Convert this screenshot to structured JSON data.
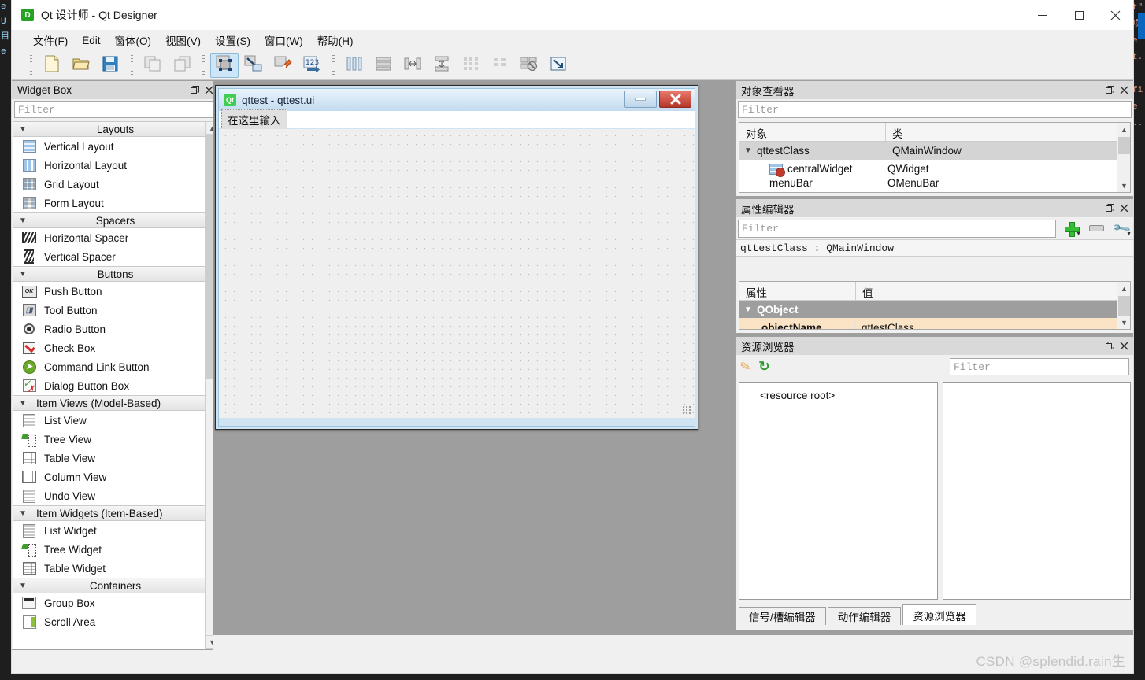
{
  "app": {
    "icon": "D",
    "title": "Qt 设计师 - Qt Designer",
    "window_controls": {
      "minimize": "minimize-icon",
      "maximize": "maximize-icon",
      "close": "close-icon"
    }
  },
  "menubar": {
    "items": [
      {
        "label": "文件(F)"
      },
      {
        "label": "Edit"
      },
      {
        "label": "窗体(O)"
      },
      {
        "label": "视图(V)"
      },
      {
        "label": "设置(S)"
      },
      {
        "label": "窗口(W)"
      },
      {
        "label": "帮助(H)"
      }
    ]
  },
  "toolbar": {
    "groups": [
      {
        "buttons": [
          {
            "name": "new-form-button",
            "icon": "new-file-icon"
          },
          {
            "name": "open-form-button",
            "icon": "open-folder-icon"
          },
          {
            "name": "save-form-button",
            "icon": "save-disk-icon"
          }
        ]
      },
      {
        "buttons": [
          {
            "name": "undo-button",
            "icon": "undo-icon"
          },
          {
            "name": "redo-button",
            "icon": "redo-icon"
          }
        ]
      },
      {
        "buttons": [
          {
            "name": "edit-widgets-button",
            "icon": "edit-widgets-icon",
            "active": true
          },
          {
            "name": "edit-signals-slots-button",
            "icon": "signals-slots-icon"
          },
          {
            "name": "edit-buddies-button",
            "icon": "buddies-icon"
          },
          {
            "name": "edit-tab-order-button",
            "icon": "tab-order-icon"
          }
        ]
      },
      {
        "buttons": [
          {
            "name": "layout-horizontally-button",
            "icon": "layout-horizontal-icon"
          },
          {
            "name": "layout-vertically-button",
            "icon": "layout-vertical-icon"
          },
          {
            "name": "layout-splitter-horizontal-button",
            "icon": "splitter-horizontal-icon"
          },
          {
            "name": "layout-splitter-vertical-button",
            "icon": "splitter-vertical-icon"
          },
          {
            "name": "layout-grid-button",
            "icon": "layout-grid-icon"
          },
          {
            "name": "layout-form-button",
            "icon": "layout-form-icon"
          },
          {
            "name": "break-layout-button",
            "icon": "break-layout-icon"
          },
          {
            "name": "adjust-size-button",
            "icon": "adjust-size-icon"
          }
        ]
      }
    ]
  },
  "widget_box": {
    "title": "Widget Box",
    "filter_placeholder": "Filter",
    "groups": [
      {
        "label": "Layouts",
        "items": [
          {
            "label": "Vertical Layout",
            "icon": "vertical-layout-icon"
          },
          {
            "label": "Horizontal Layout",
            "icon": "horizontal-layout-icon"
          },
          {
            "label": "Grid Layout",
            "icon": "grid-layout-icon"
          },
          {
            "label": "Form Layout",
            "icon": "form-layout-icon"
          }
        ]
      },
      {
        "label": "Spacers",
        "items": [
          {
            "label": "Horizontal Spacer",
            "icon": "horizontal-spacer-icon"
          },
          {
            "label": "Vertical Spacer",
            "icon": "vertical-spacer-icon"
          }
        ]
      },
      {
        "label": "Buttons",
        "items": [
          {
            "label": "Push Button",
            "icon": "push-button-icon"
          },
          {
            "label": "Tool Button",
            "icon": "tool-button-icon"
          },
          {
            "label": "Radio Button",
            "icon": "radio-button-icon"
          },
          {
            "label": "Check Box",
            "icon": "check-box-icon"
          },
          {
            "label": "Command Link Button",
            "icon": "command-link-icon"
          },
          {
            "label": "Dialog Button Box",
            "icon": "dialog-button-box-icon"
          }
        ]
      },
      {
        "label": "Item Views (Model-Based)",
        "items": [
          {
            "label": "List View",
            "icon": "list-view-icon"
          },
          {
            "label": "Tree View",
            "icon": "tree-view-icon"
          },
          {
            "label": "Table View",
            "icon": "table-view-icon"
          },
          {
            "label": "Column View",
            "icon": "column-view-icon"
          },
          {
            "label": "Undo View",
            "icon": "undo-view-icon"
          }
        ]
      },
      {
        "label": "Item Widgets (Item-Based)",
        "items": [
          {
            "label": "List Widget",
            "icon": "list-widget-icon"
          },
          {
            "label": "Tree Widget",
            "icon": "tree-widget-icon"
          },
          {
            "label": "Table Widget",
            "icon": "table-widget-icon"
          }
        ]
      },
      {
        "label": "Containers",
        "items": [
          {
            "label": "Group Box",
            "icon": "group-box-icon"
          },
          {
            "label": "Scroll Area",
            "icon": "scroll-area-icon"
          }
        ]
      }
    ]
  },
  "form_window": {
    "icon": "Qt",
    "title": "qttest - qttest.ui",
    "menu_placeholder": "在这里输入",
    "minimize_label": "minimize-icon",
    "close_label": "close-icon"
  },
  "object_inspector": {
    "title": "对象查看器",
    "filter_placeholder": "Filter",
    "columns": [
      "对象",
      "类"
    ],
    "rows": [
      {
        "object": "qttestClass",
        "class": "QMainWindow",
        "level": 0,
        "selected": true,
        "expanded": true
      },
      {
        "object": "centralWidget",
        "class": "QWidget",
        "level": 1,
        "selected": false,
        "icon": "widget-icon"
      },
      {
        "object": "menuBar",
        "class": "QMenuBar",
        "level": 1,
        "selected": false
      }
    ]
  },
  "property_editor": {
    "title": "属性编辑器",
    "filter_placeholder": "Filter",
    "object_class": "qttestClass : QMainWindow",
    "columns": [
      "属性",
      "值"
    ],
    "add_button": "add-property-icon",
    "remove_button": "remove-property-icon",
    "configure_button": "configure-icon",
    "groups": [
      {
        "label": "QObject",
        "rows": [
          {
            "name": "objectName",
            "value": "qttestClass",
            "highlighted": true
          }
        ]
      }
    ]
  },
  "resource_browser": {
    "title": "资源浏览器",
    "edit_button": "pencil-icon",
    "reload_button": "refresh-icon",
    "filter_placeholder": "Filter",
    "tree_root": "<resource root>",
    "tabs": [
      {
        "label": "信号/槽编辑器",
        "active": false
      },
      {
        "label": "动作编辑器",
        "active": false
      },
      {
        "label": "资源浏览器",
        "active": true
      }
    ]
  },
  "watermark": {
    "text": "CSDN @splendid.rain生"
  },
  "backdrop": {
    "left_lines": [
      "",
      "e",
      "",
      "",
      "",
      "U",
      "",
      "",
      "",
      "",
      "",
      "",
      "",
      "",
      "",
      "",
      "",
      "",
      "",
      "",
      "",
      "",
      "",
      "",
      "",
      "目",
      "",
      "e",
      "",
      "",
      "",
      "",
      "",
      "",
      "",
      "",
      "",
      "",
      "",
      "",
      "",
      "",
      "",
      ""
    ],
    "right_lines": [
      "",
      "",
      "t\"",
      "",
      "项",
      "e",
      "t.",
      "_",
      "",
      "fi",
      "e",
      "..",
      "",
      "",
      "",
      "",
      "",
      "",
      "",
      "",
      "",
      "",
      "",
      "",
      "",
      "",
      "",
      "",
      "",
      "",
      "",
      "",
      "",
      "",
      "",
      "",
      "",
      "",
      "",
      ""
    ]
  },
  "colors": {
    "accent": "#cde6f7",
    "panel": "#f0f0f0",
    "canvas": "#9e9e9e",
    "selection": "#d4d4d4",
    "property_highlight": "#fbe3c6",
    "group_header": "#9e9e9e"
  }
}
